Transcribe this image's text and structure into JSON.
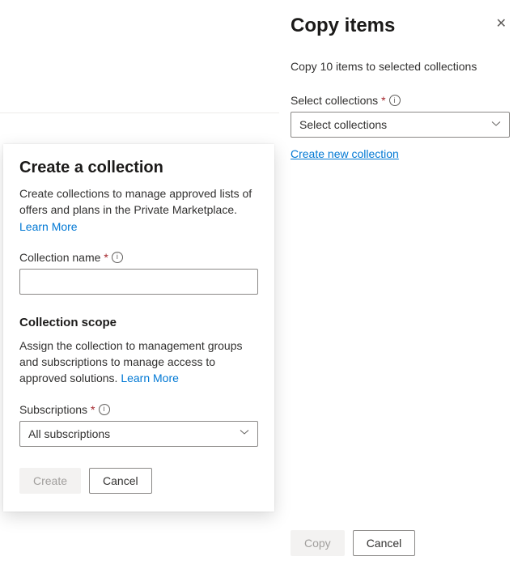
{
  "copyPanel": {
    "title": "Copy items",
    "subtext": "Copy 10 items to selected collections",
    "selectLabel": "Select collections",
    "dropdownValue": "Select collections",
    "createLink": "Create new collection",
    "copyBtn": "Copy",
    "cancelBtn": "Cancel"
  },
  "createModal": {
    "title": "Create a collection",
    "descLead": "Create collections to manage approved lists of offers and plans in the Private Marketplace. ",
    "learnMore": "Learn More",
    "nameLabel": "Collection name",
    "scopeTitle": "Collection scope",
    "scopeDesc": "Assign the collection to management groups and subscriptions to manage access to approved solutions. ",
    "subsLabel": "Subscriptions",
    "subsValue": "All subscriptions",
    "createBtn": "Create",
    "cancelBtn": "Cancel"
  }
}
